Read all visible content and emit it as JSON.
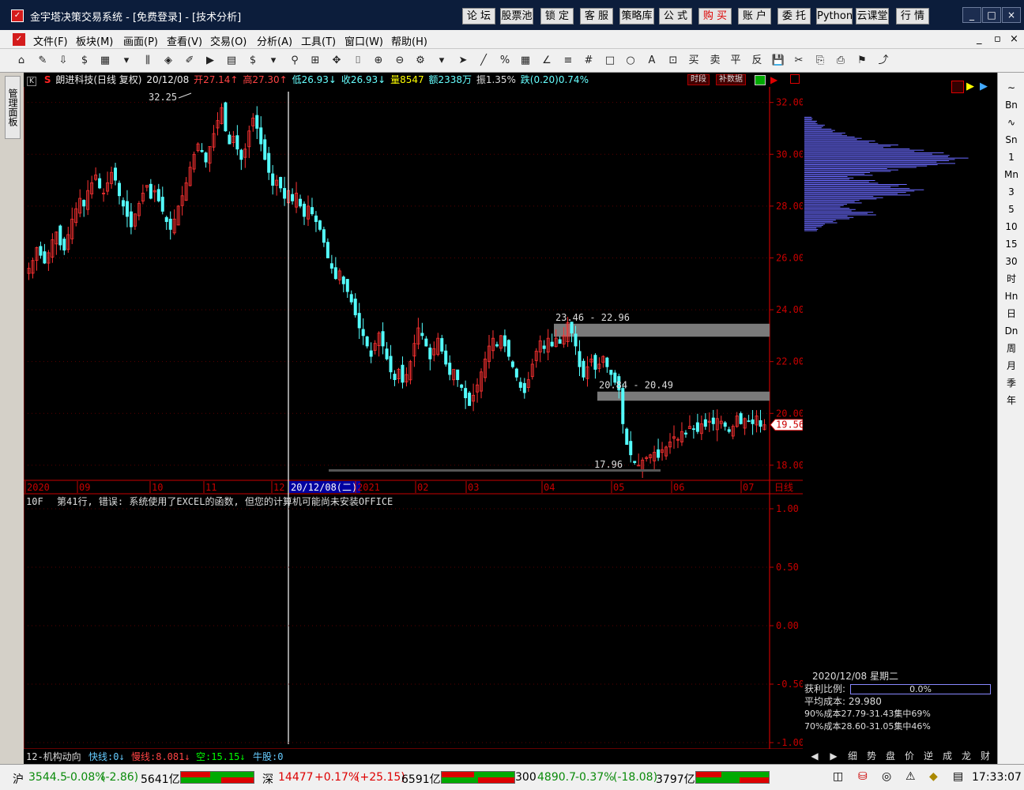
{
  "window": {
    "title": "金宇塔决策交易系统 - [免费登录] - [技术分析]",
    "top_buttons": [
      "论 坛",
      "股票池",
      "锁 定",
      "客 服",
      "策略库",
      "公 式",
      "购 买",
      "账 户",
      "委 托",
      "Python",
      "云课堂",
      "行 情"
    ],
    "window_controls": [
      "_",
      "□",
      "×"
    ]
  },
  "menu": {
    "items": [
      "文件(F)",
      "板块(M)",
      "画面(P)",
      "查看(V)",
      "交易(O)",
      "分析(A)",
      "工具(T)",
      "窗口(W)",
      "帮助(H)"
    ],
    "mdi_controls": [
      "_",
      "▫",
      "×"
    ]
  },
  "toolbar": {
    "icons": [
      "⌂",
      "✎",
      "⇩",
      "$",
      "▦",
      "▾",
      "⫼",
      "◈",
      "✐",
      "▶",
      "▤",
      "$",
      "▾",
      "⚲",
      "⊞",
      "✥",
      "⌷",
      "⊕",
      "⊖",
      "⚙",
      "▾",
      "➤",
      "╱",
      "%",
      "▦",
      "∠",
      "≡",
      "#",
      "□",
      "○",
      "A",
      "⊡",
      "买",
      "卖",
      "平",
      "反",
      "💾",
      "✂",
      "⎘",
      "⎙",
      "⚑",
      "⤴"
    ]
  },
  "left_panel": {
    "label": "管理面板"
  },
  "stock": {
    "name": "朗进科技(日线 复权)",
    "date": "20/12/08",
    "open": "开27.14↑",
    "high": "高27.30↑",
    "low": "低26.93↓",
    "close": "收26.93↓",
    "volume": "量8547",
    "amount": "额2338万",
    "amplitude": "振1.35%",
    "change": "跌(0.20)0.74%",
    "btn_period": "时段",
    "btn_data": "补数据",
    "k_label": "K",
    "s_label": "S"
  },
  "chart_data": {
    "type": "candlestick",
    "price_axis": {
      "ylim": [
        17.6,
        32.6
      ],
      "ticks": [
        "32.00",
        "30.00",
        "28.00",
        "26.00",
        "24.00",
        "22.00",
        "20.00",
        "18.00"
      ]
    },
    "time_labels": [
      "2020",
      "09",
      "10",
      "11",
      "12",
      "20/12/08(二)",
      "2021",
      "02",
      "03",
      "04",
      "05",
      "06",
      "07"
    ],
    "current_price": "19.56",
    "annotations": {
      "high": "32.25",
      "low": "17.96",
      "gap1": "23.46 - 22.96",
      "gap2": "20.84 - 20.49"
    },
    "gaps": [
      [
        22.96,
        23.46
      ],
      [
        20.49,
        20.84
      ]
    ],
    "closes": [
      25.6,
      25.9,
      26.4,
      26.1,
      25.8,
      26.2,
      26.7,
      27.0,
      26.5,
      26.3,
      26.9,
      27.5,
      27.9,
      28.3,
      28.0,
      28.6,
      28.9,
      29.2,
      28.7,
      28.5,
      28.9,
      29.3,
      29.0,
      28.4,
      28.0,
      27.6,
      27.2,
      27.7,
      28.1,
      28.5,
      28.8,
      28.3,
      28.6,
      28.2,
      27.8,
      27.4,
      27.1,
      27.5,
      28.0,
      28.4,
      28.9,
      29.5,
      30.0,
      30.4,
      30.1,
      29.7,
      30.3,
      30.8,
      31.3,
      31.8,
      30.9,
      30.4,
      30.7,
      30.2,
      29.8,
      30.2,
      30.9,
      31.4,
      31.0,
      30.4,
      29.8,
      29.3,
      28.8,
      29.0,
      28.7,
      28.3,
      28.6,
      28.2,
      28.5,
      28.0,
      27.6,
      28.0,
      27.7,
      27.4,
      27.1,
      26.6,
      26.0,
      25.6,
      25.2,
      25.5,
      25.0,
      24.7,
      24.3,
      23.8,
      23.3,
      23.0,
      22.6,
      22.2,
      22.7,
      23.1,
      22.6,
      22.1,
      21.6,
      21.3,
      21.7,
      21.2,
      21.5,
      22.0,
      22.7,
      23.3,
      23.0,
      22.6,
      22.1,
      22.5,
      22.9,
      22.4,
      21.9,
      21.5,
      21.7,
      21.3,
      21.0,
      20.6,
      20.3,
      20.7,
      21.1,
      21.6,
      22.1,
      22.6,
      22.9,
      22.6,
      23.0,
      22.6,
      22.2,
      21.8,
      21.4,
      21.0,
      20.8,
      21.3,
      21.9,
      22.4,
      22.8,
      22.5,
      22.9,
      22.6,
      22.9,
      22.7,
      23.0,
      23.5,
      23.1,
      22.6,
      21.8,
      21.4,
      21.8,
      22.1,
      21.7,
      21.9,
      22.2,
      21.8,
      21.5,
      21.2,
      20.9,
      19.6,
      18.8,
      18.4,
      18.1,
      18.0,
      18.2,
      18.3,
      18.4,
      18.5,
      18.3,
      18.6,
      18.7,
      18.9,
      19.1,
      19.0,
      19.3,
      19.2,
      19.5,
      19.4,
      19.3,
      19.6,
      19.5,
      19.7,
      19.6,
      19.8,
      19.7,
      19.5,
      19.3,
      19.5,
      19.9,
      19.6,
      19.8,
      19.7,
      19.6,
      19.9,
      19.5,
      19.56
    ]
  },
  "indicator": {
    "label": "10F",
    "error": "第41行, 错误: 系统使用了EXCEL的函数, 但您的计算机可能尚未安装OFFICE",
    "axis_ticks": [
      "1.00",
      "0.50",
      "0.00",
      "-0.50",
      "-1.00"
    ],
    "bottom_name": "12-机构动向",
    "fast": "快线:0↓",
    "slow": "慢线:8.081↓",
    "empty": "空:15.15↓",
    "bull": "牛股:0",
    "period_label": "日线"
  },
  "volume_profile": {
    "levels": [
      0.05,
      0.08,
      0.12,
      0.18,
      0.25,
      0.35,
      0.45,
      0.55,
      0.7,
      0.85,
      1.0,
      0.92,
      0.78,
      0.55,
      0.4,
      0.3,
      0.45,
      0.6,
      0.7,
      0.62,
      0.48,
      0.35,
      0.25,
      0.3,
      0.42,
      0.3,
      0.2,
      0.12,
      0.08
    ],
    "price_top": 31.43,
    "price_bottom": 27.0
  },
  "cost": {
    "date": "2020/12/08 星期二",
    "profit_label": "获利比例:",
    "profit_value": "0.0%",
    "avg_label": "平均成本:",
    "avg_value": "29.980",
    "c90": "90%成本27.79-31.43集中69%",
    "c70": "70%成本28.60-31.05集中46%"
  },
  "right_toolbar": [
    "∼",
    "Bn",
    "∿",
    "Sn",
    "1",
    "Mn",
    "3",
    "5",
    "10",
    "15",
    "30",
    "时",
    "Hn",
    "日",
    "Dn",
    "周",
    "月",
    "季",
    "年"
  ],
  "bottom_tabs": [
    "◀",
    "▶",
    "细",
    "势",
    "盘",
    "价",
    "逆",
    "成",
    "龙",
    "财"
  ],
  "status": {
    "sh_label": "沪",
    "sh_value": "3544.5",
    "sh_change": "-0.08%",
    "sh_points": "(-2.86)",
    "sh_amount": "5641亿",
    "sz_label": "深",
    "sz_value": "14477",
    "sz_change": "+0.17%",
    "sz_points": "(+25.15)",
    "sz_amount": "6591亿",
    "c300_label": "300",
    "c300_value": "4890.7",
    "c300_change": "-0.37%",
    "c300_points": "(-18.08)",
    "c300_amount": "3797亿",
    "time": "17:33:07"
  },
  "colors": {
    "up": "#ff3232",
    "down": "#54ffff",
    "axis": "#c80000",
    "profile": "#6a6aff"
  }
}
